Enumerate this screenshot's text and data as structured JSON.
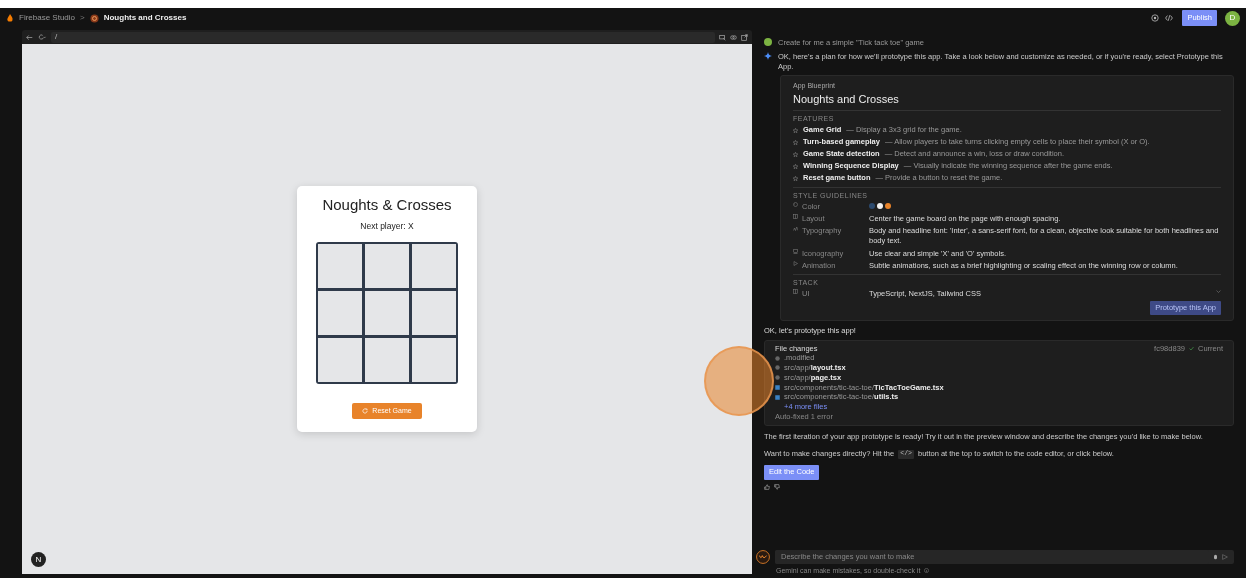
{
  "topbar": {
    "brand": "Firebase Studio",
    "separator": ">",
    "project": "Noughts and Crosses",
    "publish": "Publish",
    "avatar": "D"
  },
  "browser": {
    "url": "/"
  },
  "app": {
    "title": "Noughts & Crosses",
    "status": "Next player: X",
    "reset": "Reset Game",
    "dev_badge": "N"
  },
  "chat": {
    "user_message": {
      "text": "Create for me a simple \"Tick tack toe\" game"
    },
    "ai_message": "OK, here's a plan for how we'll prototype this app. Take a look below and customize as needed, or if you're ready, select Prototype this App.",
    "blueprint": {
      "label": "App Blueprint",
      "title": "Noughts and Crosses",
      "features_heading": "FEATURES",
      "features": [
        {
          "name": "Game Grid",
          "description": "— Display a 3x3 grid for the game."
        },
        {
          "name": "Turn-based gameplay",
          "description": "— Allow players to take turns clicking empty cells to place their symbol (X or O)."
        },
        {
          "name": "Game State detection",
          "description": "— Detect and announce a win, loss or draw condition."
        },
        {
          "name": "Winning Sequence Display",
          "description": "— Visually indicate the winning sequence after the game ends."
        },
        {
          "name": "Reset game button",
          "description": "— Provide a button to reset the game."
        }
      ],
      "style_heading": "STYLE GUIDELINES",
      "style": [
        {
          "kind": "colors",
          "label": "Color",
          "colors": [
            {
              "color": "#2c4a6e"
            },
            {
              "color": "#f2f2f2"
            },
            {
              "color": "#e8832a"
            }
          ]
        },
        {
          "kind": "layout",
          "label": "Layout",
          "value": "Center the game board on the page with enough spacing."
        },
        {
          "kind": "typography",
          "label": "Typography",
          "value": "Body and headline font: 'Inter', a sans-serif font, for a clean, objective look suitable for both headlines and body text."
        },
        {
          "kind": "iconography",
          "label": "Iconography",
          "value": "Use clear and simple 'X' and 'O' symbols."
        },
        {
          "kind": "animation",
          "label": "Animation",
          "value": "Subtle animations, such as a brief highlighting or scaling effect on the winning row or column."
        }
      ],
      "stack_heading": "STACK",
      "stack": {
        "label": "UI",
        "value": "TypeScript, NextJS, Tailwind CSS"
      },
      "prototype_button": "Prototype this App"
    },
    "ok_message": "OK, let's prototype this app!",
    "file_changes": {
      "title": "File changes",
      "commit": "fc98d839",
      "status": "Current",
      "files": [
        {
          "kind": "other",
          "path": ".modified"
        },
        {
          "kind": "other",
          "path": "src/app/**layout.tsx**"
        },
        {
          "kind": "other",
          "path": "src/app/**page.tsx**"
        },
        {
          "kind": "code",
          "path": "src/components/tic-tac-toe/**TicTacToeGame.tsx**"
        },
        {
          "kind": "code",
          "path": "src/components/tic-tac-toe/**utils.ts**"
        }
      ],
      "more": "+4 more files",
      "note": "Auto-fixed 1 error"
    },
    "ready_message": "The first iteration of your app prototype is ready! Try it out in the preview window and describe the changes you'd like to make below.",
    "code_message": {
      "before": "Want to make changes directly? Hit the",
      "code": "</>",
      "after": "button at the top to switch to the code editor, or click below."
    },
    "edit_button": "Edit the Code",
    "input": {
      "placeholder": "Describe the changes you want to make"
    },
    "disclaimer": "Gemini can make mistakes, so double-check it"
  }
}
